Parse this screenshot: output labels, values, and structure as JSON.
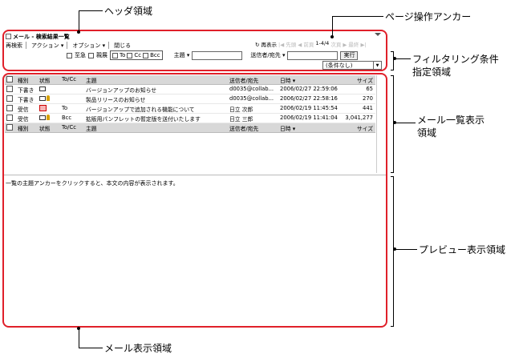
{
  "callouts": {
    "header_area": "ヘッダ領域",
    "page_anchor": "ページ操作アンカー",
    "filter_area_line1": "フィルタリング条件",
    "filter_area_line2": "指定領域",
    "list_area_line1": "メール一覧表示",
    "list_area_line2": "領域",
    "preview_area": "プレビュー表示領域",
    "mail_area": "メール表示領域"
  },
  "window": {
    "title": "メール - 検索結果一覧"
  },
  "menu": {
    "research": "再検索",
    "action": "アクション ▾",
    "option": "オプション ▾",
    "close": "閉じる"
  },
  "pager": {
    "refresh": "↻ 再表示",
    "first": "|◀ 先頭",
    "prev": "◀ 前頁",
    "range": "1-4/4",
    "next": "次頁 ▶",
    "last": "最終 ▶|"
  },
  "filters": {
    "urgent": "至急",
    "confidential": "親展",
    "to": "To",
    "cc": "Cc",
    "bcc": "Bcc",
    "subject_label": "主題 ▾",
    "sender_label": "送信者/宛先 ▾",
    "execute": "実行",
    "condition": "(条件なし)"
  },
  "table": {
    "columns": [
      "種別",
      "状態",
      "To/Cc",
      "主題",
      "送信者/宛先",
      "日時 ▾",
      "サイズ"
    ],
    "rows": [
      {
        "type": "下書き",
        "status": "envelope",
        "tocc": "",
        "subject": "バージョンアップのお知らせ",
        "sender": "d0035@collab...",
        "date": "2006/02/27 22:59:06",
        "size": "65"
      },
      {
        "type": "下書き",
        "status": "envelope-key",
        "tocc": "",
        "subject": "製品リリースのお知らせ",
        "sender": "d0035@collab...",
        "date": "2006/02/27 22:58:16",
        "size": "270"
      },
      {
        "type": "受信",
        "status": "home",
        "tocc": "To",
        "subject": "バージョンアップで追加される機能について",
        "sender": "日立 次郎",
        "date": "2006/02/19 11:45:54",
        "size": "441"
      },
      {
        "type": "受信",
        "status": "envelope-key",
        "tocc": "Bcc",
        "subject": "拡販用パンフレットの暫定版を送付いたします",
        "sender": "日立 三郎",
        "date": "2006/02/19 11:41:04",
        "size": "3,041,277"
      }
    ]
  },
  "preview": {
    "message": "一覧の主題アンカーをクリックすると、本文の内容が表示されます。"
  }
}
